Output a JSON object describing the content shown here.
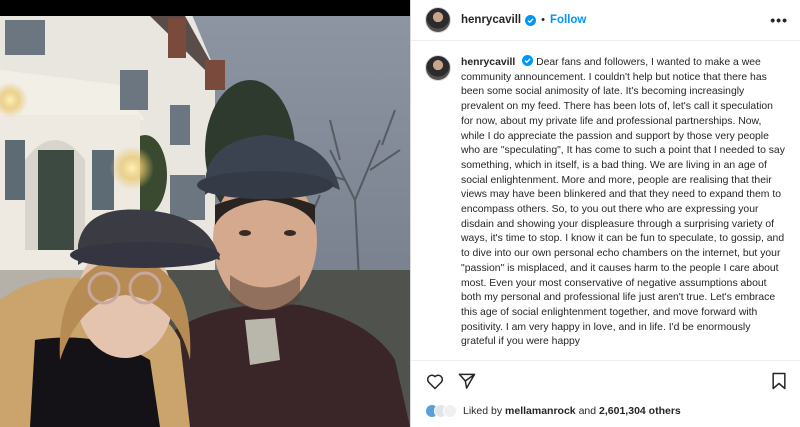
{
  "post": {
    "username": "henrycavill",
    "follow_label": "Follow",
    "separator": "•",
    "more_label": "•••",
    "caption_user": "henrycavill",
    "caption_text": "Dear fans and followers, I wanted to make a wee community announcement. I couldn't help but notice that there has been some social animosity of late. It's becoming increasingly prevalent on my feed. There has been lots of, let's call it speculation for now, about my private life and professional partnerships. Now, while I do appreciate the passion and support by those very people who are \"speculating\", It has come to such a point that I needed to say something, which in itself, is a bad thing. We are living in an age of social enlightenment. More and more, people are realising that their views may have been blinkered and that they need to expand them to encompass others. So, to you out there who are expressing your disdain and showing your displeasure through a surprising variety of ways, it's time to stop. I know it can be fun to speculate, to gossip, and to dive into our own personal echo chambers on the internet, but your \"passion\" is misplaced, and it causes harm to the people I care about most. Even your most conservative of negative assumptions about both my personal and professional life just aren't true. Let's embrace this age of social enlightenment together, and move forward with positivity. I am very happy in love, and in life. I'd be enormously grateful if you were happy",
    "likes_prefix": "Liked by",
    "likes_user": "mellamanrock",
    "likes_and": "and",
    "likes_count": "2,601,304 others"
  },
  "icons": {
    "like": "heart-icon",
    "share": "send-icon",
    "save": "bookmark-icon",
    "verified": "verified-badge-icon",
    "more": "more-options-icon"
  },
  "colors": {
    "accent": "#0095f6",
    "text": "#262626",
    "border": "#dbdbdb"
  }
}
